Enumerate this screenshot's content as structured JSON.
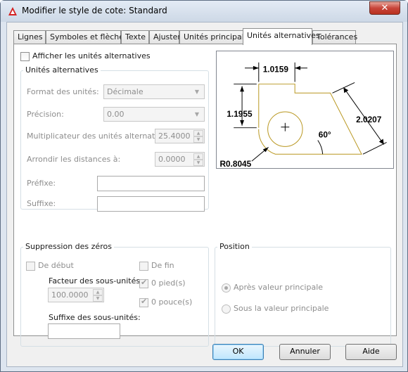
{
  "window": {
    "title": "Modifier le style de cote: Standard",
    "close_glyph": "✕"
  },
  "tabs": [
    {
      "label": "Lignes"
    },
    {
      "label": "Symboles et flèches"
    },
    {
      "label": "Texte"
    },
    {
      "label": "Ajuster"
    },
    {
      "label": "Unités principales"
    },
    {
      "label": "Unités alternatives"
    },
    {
      "label": "Tolérances"
    }
  ],
  "active_tab": "Unités alternatives",
  "show_alt_units": {
    "label": "Afficher les unités alternatives",
    "checked": false
  },
  "alt_units": {
    "group_label": "Unités alternatives",
    "unit_format": {
      "label": "Format des unités:",
      "value": "Décimale"
    },
    "precision": {
      "label": "Précision:",
      "value": "0.00"
    },
    "multiplier": {
      "label": "Multiplicateur des unités alternatives:",
      "value": "25.4000"
    },
    "round_off": {
      "label": "Arrondir les distances à:",
      "value": "0.0000"
    },
    "prefix": {
      "label": "Préfixe:",
      "value": ""
    },
    "suffix": {
      "label": "Suffixe:",
      "value": ""
    }
  },
  "zero_suppression": {
    "group_label": "Suppression des zéros",
    "leading": {
      "label": "De début",
      "checked": false
    },
    "trailing": {
      "label": "De fin",
      "checked": false
    },
    "sub_units_factor": {
      "label": "Facteur des sous-unités:",
      "value": "100.0000"
    },
    "sub_units_suffix": {
      "label": "Suffixe des sous-unités:",
      "value": ""
    },
    "zero_feet": {
      "label": "0 pied(s)",
      "checked": true
    },
    "zero_inches": {
      "label": "0 pouce(s)",
      "checked": true
    }
  },
  "position": {
    "group_label": "Position",
    "after_primary": {
      "label": "Après valeur principale",
      "selected": true
    },
    "below_primary": {
      "label": "Sous la valeur principale",
      "selected": false
    }
  },
  "preview": {
    "dim_top": "1.0159",
    "dim_left": "1.1955",
    "dim_right": "2.0207",
    "dim_angle": "60°",
    "dim_radius": "R0.8045",
    "line_color": "#b8961e"
  },
  "buttons": {
    "ok": "OK",
    "cancel": "Annuler",
    "help": "Aide"
  }
}
